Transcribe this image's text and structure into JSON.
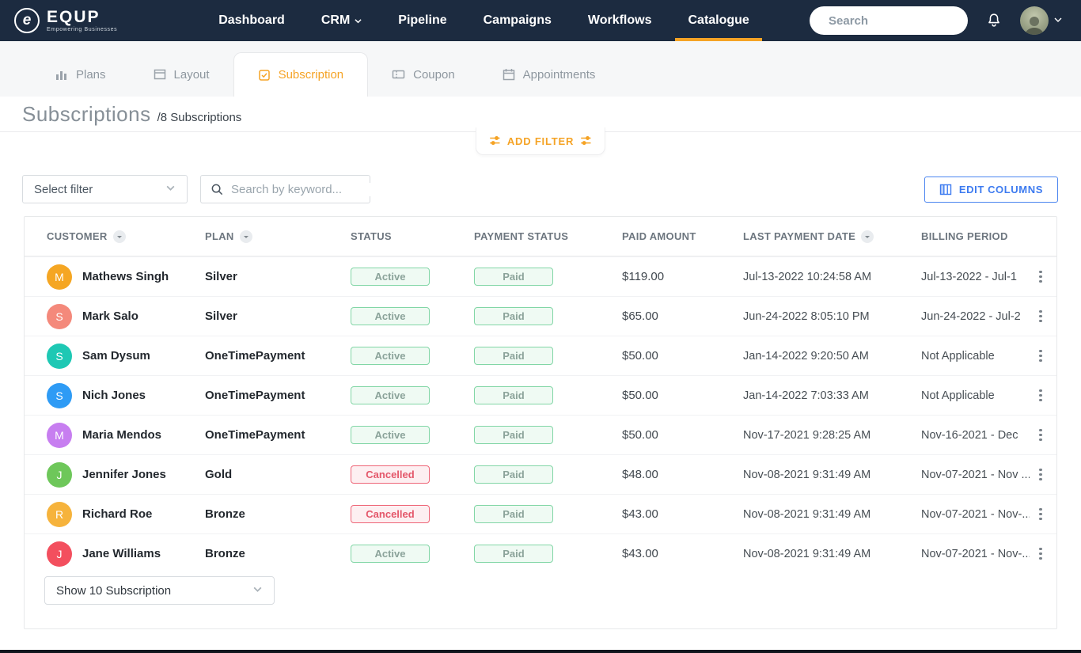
{
  "brand": {
    "name": "EQUP",
    "tagline": "Empowering Businesses",
    "initial": "e"
  },
  "nav": {
    "items": [
      {
        "label": "Dashboard"
      },
      {
        "label": "CRM"
      },
      {
        "label": "Pipeline"
      },
      {
        "label": "Campaigns"
      },
      {
        "label": "Workflows"
      },
      {
        "label": "Catalogue"
      }
    ],
    "active": "Catalogue",
    "search_placeholder": "Search"
  },
  "tabs": [
    {
      "label": "Plans"
    },
    {
      "label": "Layout"
    },
    {
      "label": "Subscription"
    },
    {
      "label": "Coupon"
    },
    {
      "label": "Appointments"
    }
  ],
  "active_tab": "Subscription",
  "page": {
    "title": "Subscriptions",
    "subtitle": "/8 Subscriptions"
  },
  "filters": {
    "add_filter_label": "ADD FILTER",
    "select_filter_value": "Select filter",
    "keyword_placeholder": "Search by keyword...",
    "edit_columns_label": "EDIT COLUMNS"
  },
  "colors": {
    "navbar": "#1c2b40",
    "accent_orange": "#f5a325",
    "accent_blue": "#3d7bf0",
    "badge_active_border": "#82d6a6",
    "badge_cancelled_border": "#ee6577"
  },
  "table": {
    "columns": [
      {
        "label": "CUSTOMER",
        "sortable": true
      },
      {
        "label": "PLAN",
        "sortable": true
      },
      {
        "label": "STATUS",
        "sortable": false
      },
      {
        "label": "PAYMENT STATUS",
        "sortable": false
      },
      {
        "label": "PAID AMOUNT",
        "sortable": false
      },
      {
        "label": "LAST PAYMENT DATE",
        "sortable": true
      },
      {
        "label": "BILLING PERIOD",
        "sortable": false
      }
    ],
    "rows": [
      {
        "initial": "M",
        "avatar_color": "#f5a623",
        "name": "Mathews Singh",
        "plan": "Silver",
        "status": "Active",
        "status_variant": "active",
        "payment_status": "Paid",
        "paid_amount": "$119.00",
        "last_payment": "Jul-13-2022 10:24:58 AM",
        "billing_period": "Jul-13-2022 - Jul-1"
      },
      {
        "initial": "S",
        "avatar_color": "#f4897b",
        "name": "Mark Salo",
        "plan": "Silver",
        "status": "Active",
        "status_variant": "active",
        "payment_status": "Paid",
        "paid_amount": "$65.00",
        "last_payment": "Jun-24-2022 8:05:10 PM",
        "billing_period": "Jun-24-2022 - Jul-2"
      },
      {
        "initial": "S",
        "avatar_color": "#1ec8b4",
        "name": "Sam Dysum",
        "plan": "OneTimePayment",
        "status": "Active",
        "status_variant": "active",
        "payment_status": "Paid",
        "paid_amount": "$50.00",
        "last_payment": "Jan-14-2022 9:20:50 AM",
        "billing_period": "Not Applicable"
      },
      {
        "initial": "S",
        "avatar_color": "#2e9bf5",
        "name": "Nich Jones",
        "plan": "OneTimePayment",
        "status": "Active",
        "status_variant": "active",
        "payment_status": "Paid",
        "paid_amount": "$50.00",
        "last_payment": "Jan-14-2022 7:03:33 AM",
        "billing_period": "Not Applicable"
      },
      {
        "initial": "M",
        "avatar_color": "#c77ef0",
        "name": "Maria Mendos",
        "plan": "OneTimePayment",
        "status": "Active",
        "status_variant": "active",
        "payment_status": "Paid",
        "paid_amount": "$50.00",
        "last_payment": "Nov-17-2021 9:28:25 AM",
        "billing_period": "Nov-16-2021 - Dec"
      },
      {
        "initial": "J",
        "avatar_color": "#6ec75a",
        "name": "Jennifer Jones",
        "plan": "Gold",
        "status": "Cancelled",
        "status_variant": "cancelled",
        "payment_status": "Paid",
        "paid_amount": "$48.00",
        "last_payment": "Nov-08-2021 9:31:49 AM",
        "billing_period": "Nov-07-2021 - Nov ..."
      },
      {
        "initial": "R",
        "avatar_color": "#f6b33c",
        "name": "Richard Roe",
        "plan": "Bronze",
        "status": "Cancelled",
        "status_variant": "cancelled",
        "payment_status": "Paid",
        "paid_amount": "$43.00",
        "last_payment": "Nov-08-2021 9:31:49 AM",
        "billing_period": "Nov-07-2021 - Nov-..."
      },
      {
        "initial": "J",
        "avatar_color": "#f34f5e",
        "name": "Jane Williams",
        "plan": "Bronze",
        "status": "Active",
        "status_variant": "active",
        "payment_status": "Paid",
        "paid_amount": "$43.00",
        "last_payment": "Nov-08-2021 9:31:49 AM",
        "billing_period": "Nov-07-2021 - Nov-..."
      }
    ]
  },
  "footer": {
    "page_size_value": "Show 10 Subscription"
  }
}
